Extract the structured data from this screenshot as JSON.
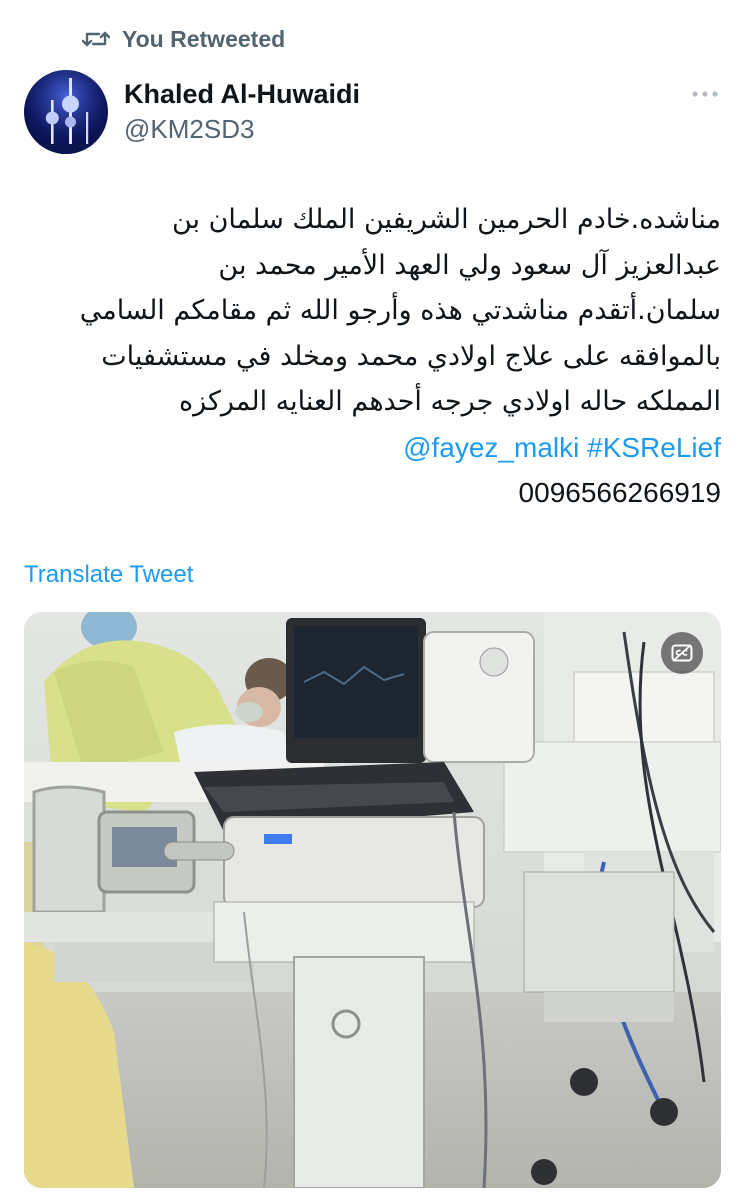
{
  "retweet_banner": {
    "icon": "retweet-icon",
    "label": "You Retweeted"
  },
  "tweet": {
    "author": {
      "name": "Khaled Al-Huwaidi",
      "handle": "@KM2SD3",
      "avatar_icon": "kuwait-towers-avatar"
    },
    "more_icon": "more-dots-icon",
    "text_lines": [
      "مناشده.خادم الحرمين الشريفين الملك سلمان بن",
      "عبدالعزيز آل سعود ولي العهد الأمير محمد بن",
      "سلمان.أتقدم مناشدتي هذه وأرجو الله ثم مقامكم السامي",
      "بالموافقه على علاج اولادي محمد ومخلد في مستشفيات",
      "المملكه  حاله اولادي جرجه أحدهم العنايه المركزه"
    ],
    "mention": "@fayez_malki",
    "hashtag": "#KSReLief",
    "phone": "0096566266919",
    "translate_label": "Translate Tweet",
    "media": {
      "description_icon": "closed-captions-icon"
    }
  },
  "colors": {
    "link": "#1d9bf0",
    "secondary_text": "#536471",
    "primary_text": "#0f1419"
  }
}
